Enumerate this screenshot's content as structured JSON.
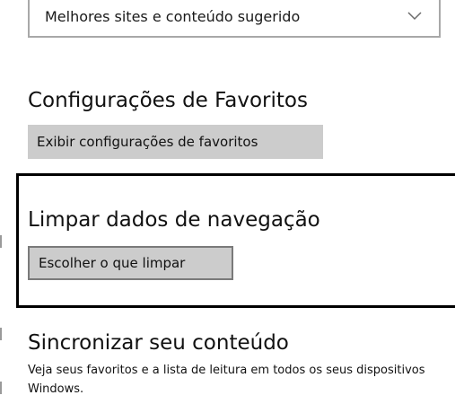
{
  "dropdown": {
    "selected": "Melhores sites e conteúdo sugerido",
    "icon": "chevron-down-icon"
  },
  "favorites": {
    "title": "Configurações de Favoritos",
    "button_label": "Exibir configurações de favoritos"
  },
  "clear_data": {
    "title": "Limpar dados de navegação",
    "button_label": "Escolher o que limpar"
  },
  "sync": {
    "title": "Sincronizar seu conteúdo",
    "description": "Veja seus favoritos e a lista de leitura em todos os seus dispositivos Windows."
  },
  "colors": {
    "button_bg": "#cccccc",
    "highlight_border": "#000000",
    "text": "#111111"
  }
}
